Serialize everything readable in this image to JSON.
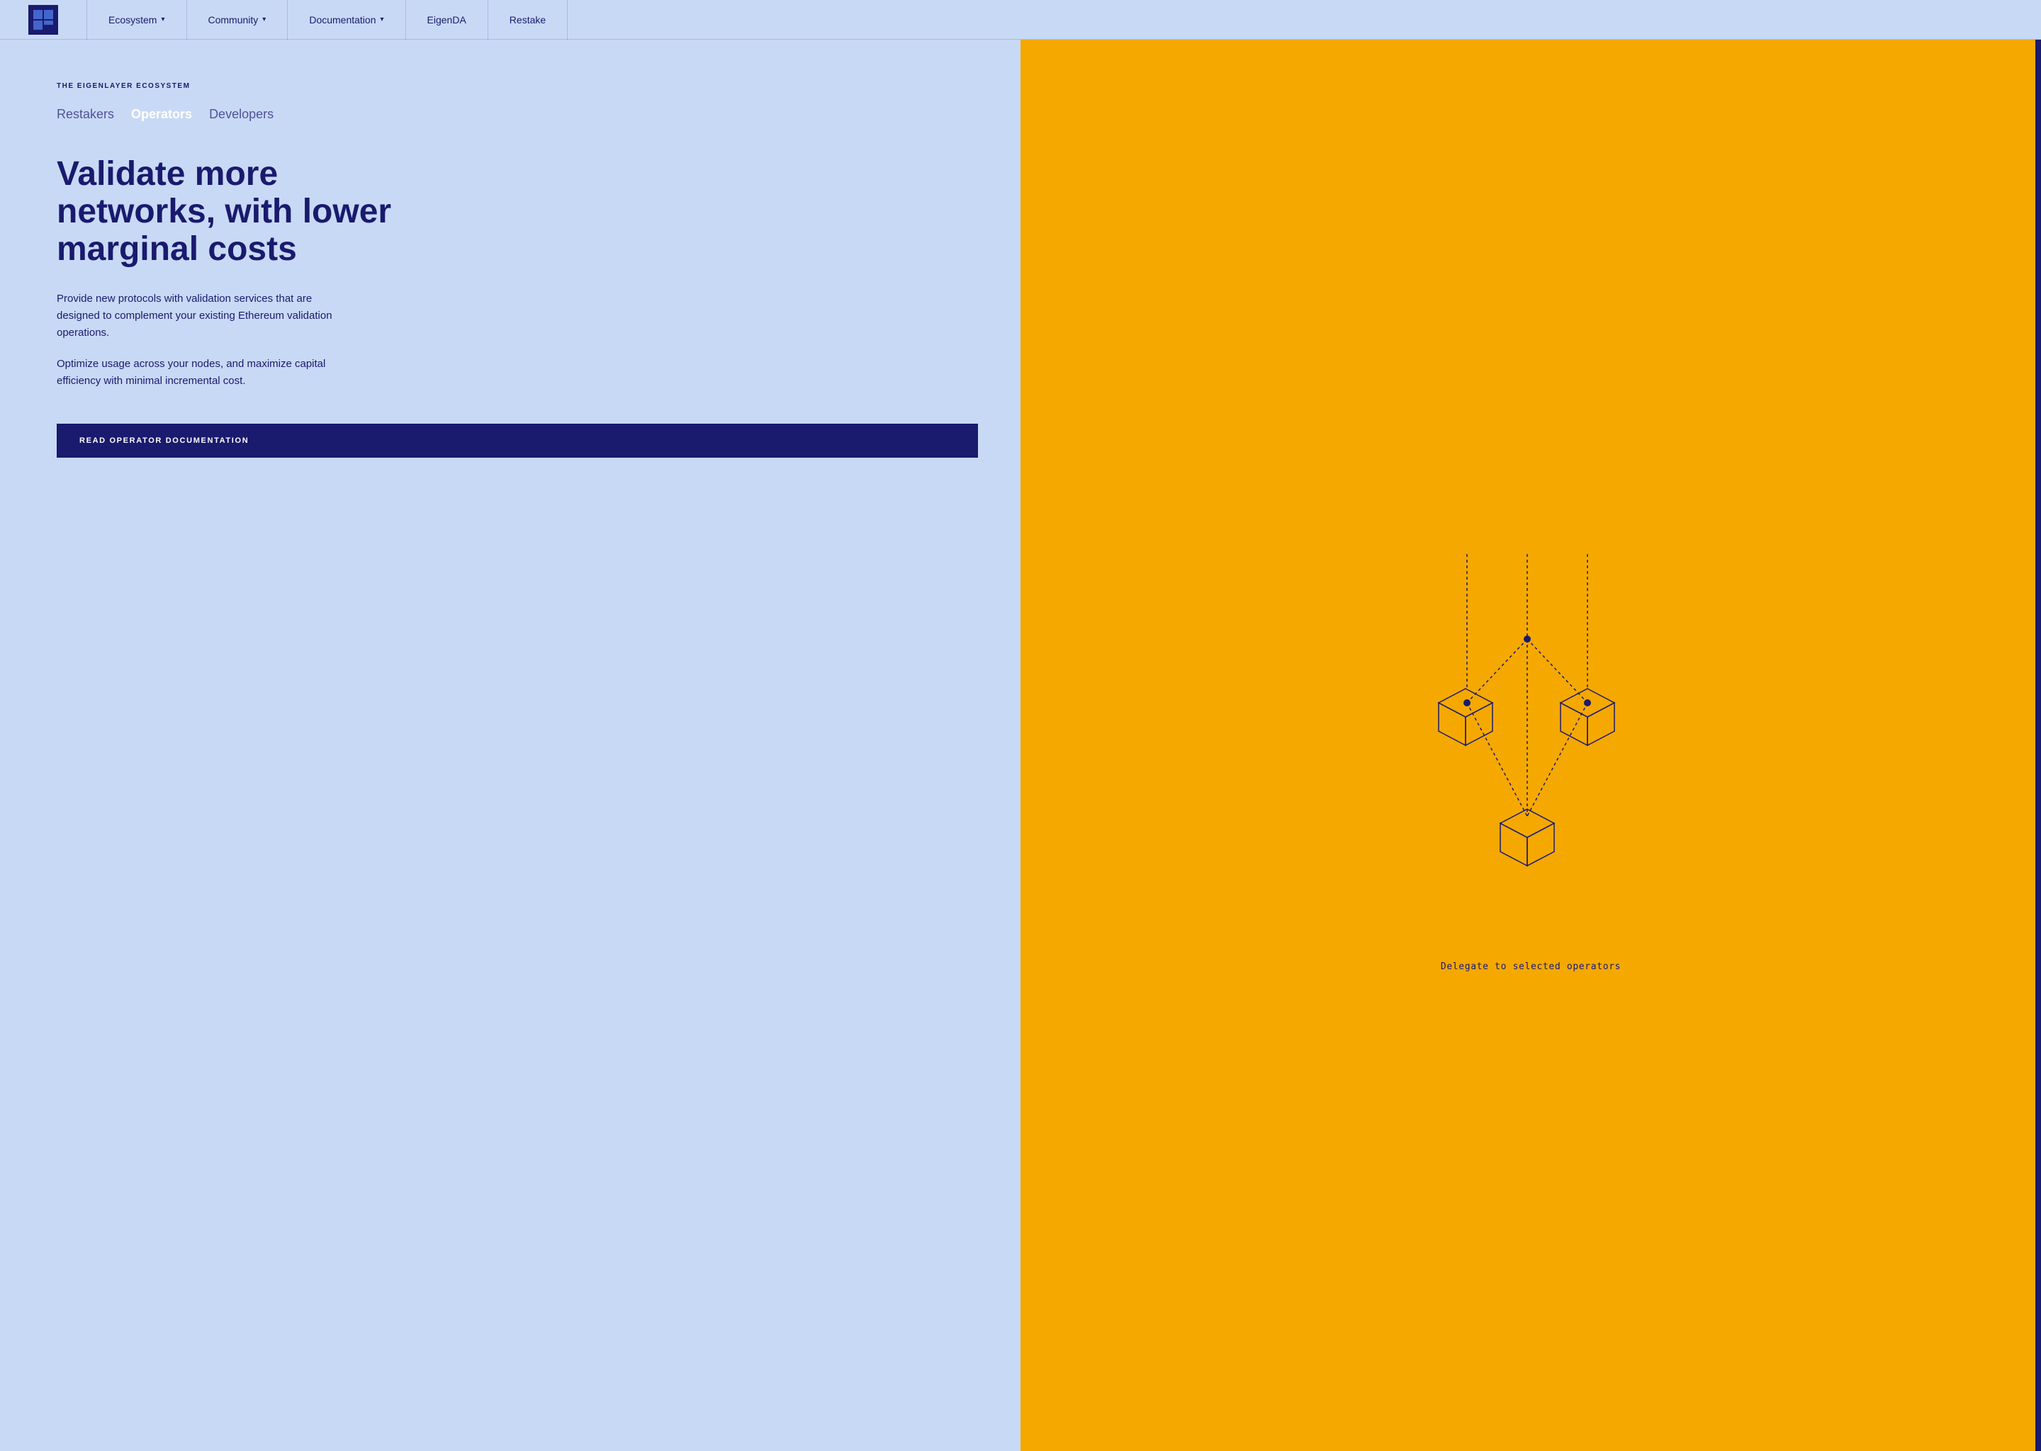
{
  "nav": {
    "logo_alt": "EigenLayer Logo",
    "links": [
      {
        "label": "Ecosystem",
        "has_dropdown": true,
        "id": "ecosystem"
      },
      {
        "label": "Community",
        "has_dropdown": true,
        "id": "community"
      },
      {
        "label": "Documentation",
        "has_dropdown": true,
        "id": "documentation"
      },
      {
        "label": "EigenDA",
        "has_dropdown": false,
        "id": "eigenda"
      },
      {
        "label": "Restake",
        "has_dropdown": false,
        "id": "restake"
      }
    ]
  },
  "hero": {
    "ecosystem_label": "THE EIGENLAYER ECOSYSTEM",
    "tabs": [
      {
        "label": "Restakers",
        "active": false,
        "id": "restakers"
      },
      {
        "label": "Operators",
        "active": true,
        "id": "operators"
      },
      {
        "label": "Developers",
        "active": false,
        "id": "developers"
      }
    ],
    "title": "Validate more networks, with lower marginal costs",
    "description1": "Provide new protocols with validation services that are designed to complement your existing Ethereum validation operations.",
    "description2": "Optimize usage across your nodes, and maximize capital efficiency with minimal incremental cost.",
    "cta_button": "READ OPERATOR DOCUMENTATION"
  },
  "diagram": {
    "label": "Delegate to selected operators"
  }
}
